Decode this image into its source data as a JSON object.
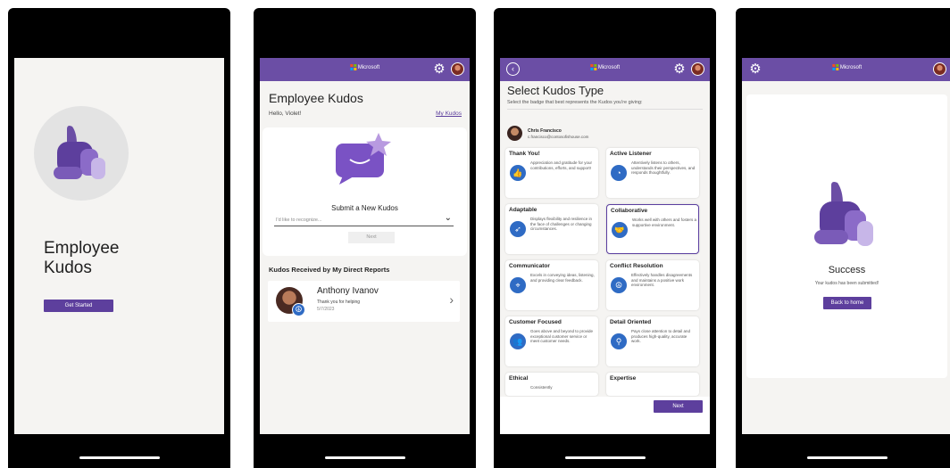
{
  "colors": {
    "accent": "#6b4ea5",
    "button": "#5d3f9d",
    "icon_blue": "#2f6bc4",
    "background": "#f5f4f2"
  },
  "brand": "Microsoft",
  "screen1": {
    "title_line1": "Employee",
    "title_line2": "Kudos",
    "cta": "Get Started"
  },
  "screen2": {
    "title": "Employee Kudos",
    "greeting": "Hello, Violet!",
    "my_kudos": "My Kudos",
    "submit_title": "Submit a New Kudos",
    "input_placeholder": "I'd like to recognize...",
    "next": "Next",
    "received_heading": "Kudos Received by My Direct Reports",
    "received": {
      "name": "Anthony Ivanov",
      "message": "Thank you for helping",
      "date": "5/7/2023"
    }
  },
  "screen3": {
    "title": "Select Kudos Type",
    "subtitle": "Select the badge that best represents the Kudos you're giving:",
    "recipient": {
      "name": "Chris Francisco",
      "email": "c.francisco@contosofishouse.com"
    },
    "types": [
      {
        "title": "Thank You!",
        "desc": "Appreciation and gratitude for your contributions, efforts, and support!",
        "icon": "thumbs-up-icon"
      },
      {
        "title": "Active Listener",
        "desc": "Attentively listens to others, understands their perspectives, and responds thoughtfully.",
        "icon": "ear-icon"
      },
      {
        "title": "Adaptable",
        "desc": "Displays flexibility and resilience in the face of challenges or changing circumstances.",
        "icon": "runner-icon"
      },
      {
        "title": "Collaborative",
        "desc": "Works well with others and fosters a supportive environment.",
        "icon": "handshake-icon"
      },
      {
        "title": "Communicator",
        "desc": "Excels in conveying ideas, listening, and providing clear feedback.",
        "icon": "broadcast-icon"
      },
      {
        "title": "Conflict Resolution",
        "desc": "Effectively handles disagreements and maintains a positive work environment.",
        "icon": "peace-icon"
      },
      {
        "title": "Customer Focused",
        "desc": "Goes above and beyond to provide exceptional customer service or meet customer needs.",
        "icon": "people-icon"
      },
      {
        "title": "Detail Oriented",
        "desc": "Pays close attention to detail and produces high-quality, accurate work.",
        "icon": "magnifier-icon"
      },
      {
        "title": "Ethical",
        "desc": "Consistently",
        "icon": ""
      },
      {
        "title": "Expertise",
        "desc": "",
        "icon": ""
      }
    ],
    "next": "Next"
  },
  "screen4": {
    "success": "Success",
    "message": "Your kudos has been submitted!",
    "back": "Back to home"
  }
}
